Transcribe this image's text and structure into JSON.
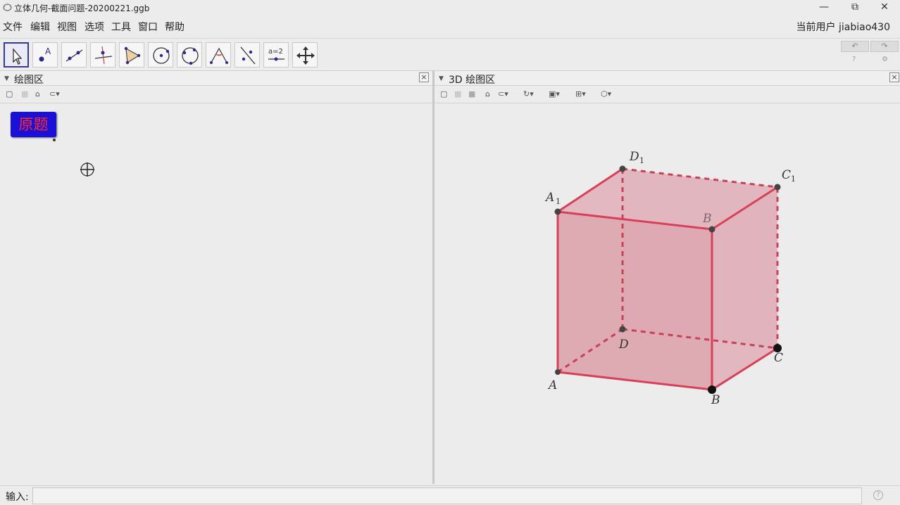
{
  "window": {
    "title": "立体几何-截面问题-20200221.ggb",
    "minimize": "—",
    "restore": "⧉",
    "close": "✕"
  },
  "menu": {
    "items": [
      "文件",
      "编辑",
      "视图",
      "选项",
      "工具",
      "窗口",
      "帮助"
    ],
    "user_label": "当前用户 jiabiao430"
  },
  "toolbar": {
    "tools": [
      "move-tool",
      "point-tool",
      "line-tool",
      "perpendicular-tool",
      "polygon-tool",
      "circle-tool",
      "circle-3pt-tool",
      "angle-tool",
      "reflect-tool",
      "slider-tool",
      "move-view-tool"
    ],
    "slider_text": "a=2",
    "undo": "↶",
    "redo": "↷",
    "help_small": "?",
    "settings_small": "⚙"
  },
  "panels": {
    "graphics": {
      "title": "绘图区"
    },
    "view3d": {
      "title": "3D 绘图区"
    }
  },
  "graphics": {
    "button_label": "原题"
  },
  "view3d": {
    "points": {
      "A": "A",
      "B": "B",
      "C": "C",
      "D": "D",
      "A1": "A",
      "B1": "B",
      "C1": "C",
      "D1": "D",
      "sub1": "1"
    },
    "colors": {
      "face": "#e38a98",
      "edge": "#d8405a",
      "point": "#333333"
    }
  },
  "input": {
    "label": "输入:",
    "value": "",
    "help": "?"
  }
}
